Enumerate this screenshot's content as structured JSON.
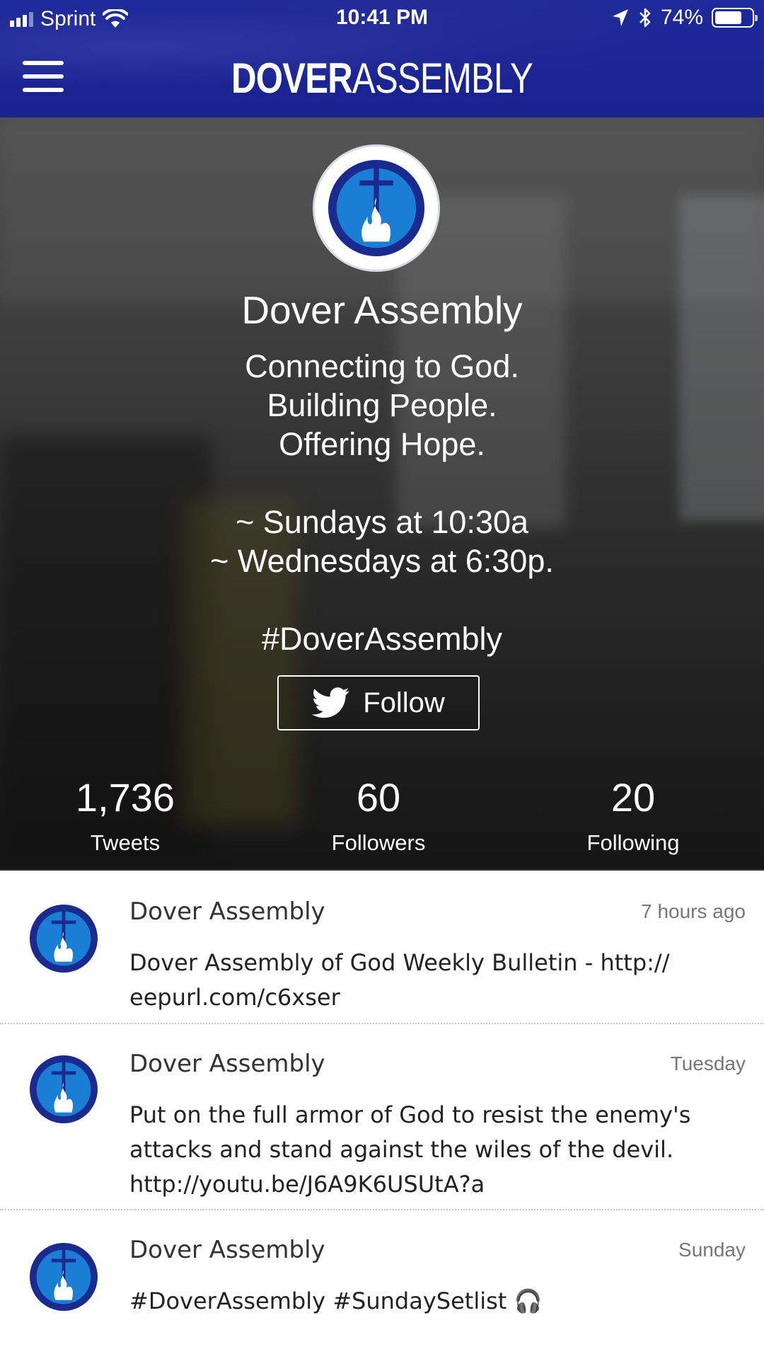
{
  "status_bar": {
    "carrier": "Sprint",
    "time": "10:41 PM",
    "battery": "74%"
  },
  "header": {
    "brand_bold": "DOVER",
    "brand_light": "ASSEMBLY"
  },
  "profile": {
    "name": "Dover Assembly",
    "bio_lines": [
      "Connecting to God.",
      "Building People.",
      "Offering Hope.",
      "",
      "~ Sundays at 10:30a",
      "~ Wednesdays at 6:30p.",
      "",
      "#DoverAssembly"
    ],
    "follow_label": "Follow",
    "stats": [
      {
        "value": "1,736",
        "label": "Tweets"
      },
      {
        "value": "60",
        "label": "Followers"
      },
      {
        "value": "20",
        "label": "Following"
      }
    ]
  },
  "tweets": [
    {
      "author": "Dover Assembly",
      "time": "7 hours ago",
      "lines": [
        "Dover Assembly of God Weekly Bulletin - http://",
        "eepurl.com/c6xser"
      ]
    },
    {
      "author": "Dover Assembly",
      "time": "Tuesday",
      "lines": [
        "Put on the full armor of God to resist the enemy's",
        "attacks and stand against the wiles of the devil.",
        "http://youtu.be/J6A9K6USUtA?a"
      ]
    },
    {
      "author": "Dover Assembly",
      "time": "Sunday",
      "lines": [
        "#DoverAssembly #SundaySetlist 🎧"
      ]
    }
  ],
  "colors": {
    "header_bg": "#1e2a9a",
    "logo_blue": "#1a7fd4",
    "logo_navy": "#1b2a8f"
  },
  "icons": [
    "signal-icon",
    "wifi-icon",
    "location-icon",
    "bluetooth-icon",
    "battery-icon",
    "menu-icon",
    "twitter-bird-icon",
    "church-logo-icon"
  ]
}
